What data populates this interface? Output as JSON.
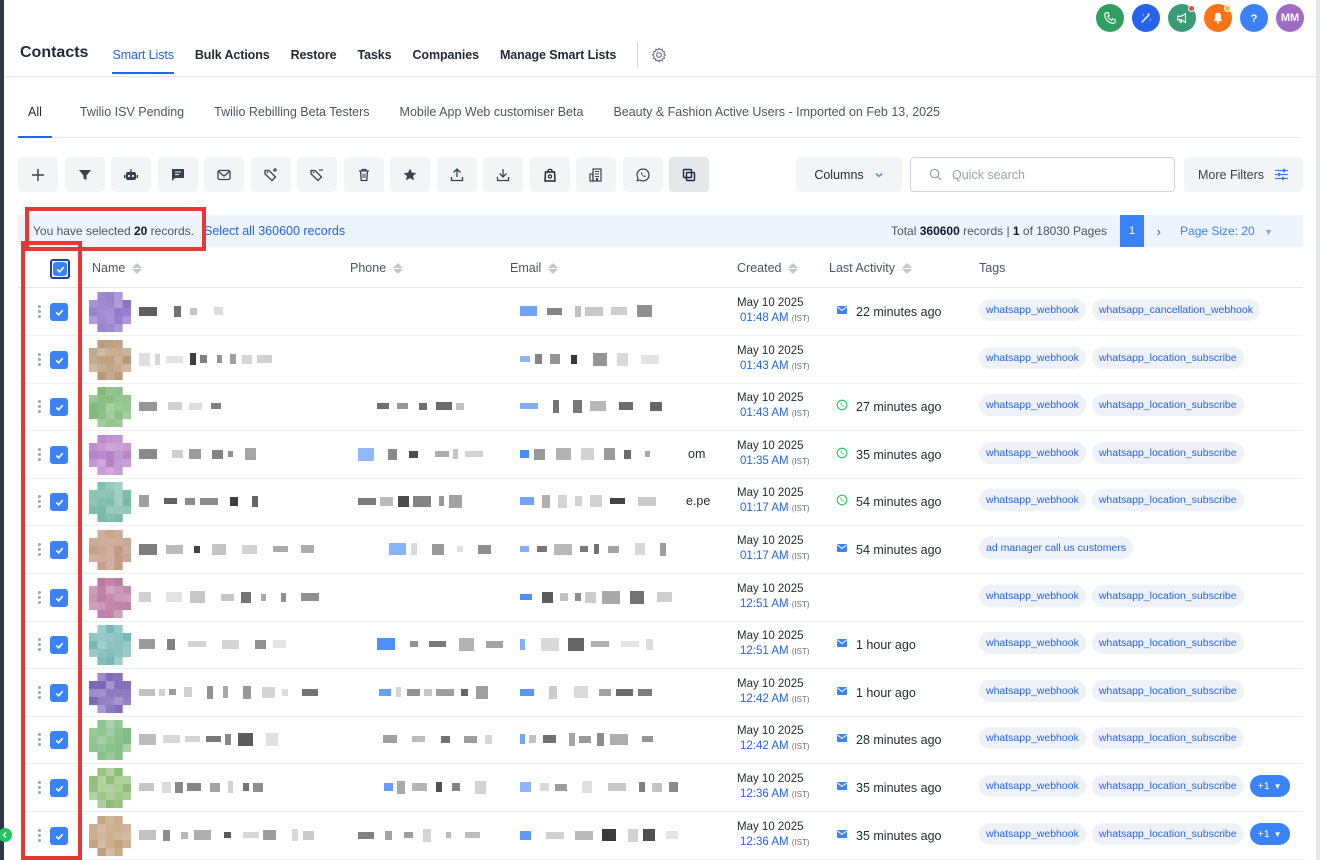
{
  "header": {
    "title": "Contacts",
    "nav_tabs": [
      {
        "label": "Smart Lists",
        "active": true
      },
      {
        "label": "Bulk Actions"
      },
      {
        "label": "Restore"
      },
      {
        "label": "Tasks"
      },
      {
        "label": "Companies"
      },
      {
        "label": "Manage Smart Lists"
      }
    ],
    "icons": [
      {
        "name": "phone-icon",
        "color": "#2f9e5f"
      },
      {
        "name": "magic-wand-icon",
        "color": "#2563eb"
      },
      {
        "name": "megaphone-icon",
        "color": "#3c9a74"
      },
      {
        "name": "bell-icon",
        "color": "#f97316"
      },
      {
        "name": "help-icon",
        "color": "#3b82f6"
      }
    ],
    "user_initials": "MM",
    "user_color": "#a26ac7"
  },
  "smart_lists": [
    "All",
    "Twilio ISV Pending",
    "Twilio Rebilling Beta Testers",
    "Mobile App Web customiser Beta",
    "Beauty & Fashion Active Users - Imported on Feb 13, 2025"
  ],
  "toolbar": {
    "columns_label": "Columns",
    "search_placeholder": "Quick search",
    "more_filters_label": "More Filters"
  },
  "selection": {
    "prefix": "You have selected ",
    "count": "20",
    "suffix": " records.",
    "select_all": "Select all 360600 records",
    "total_prefix": "Total ",
    "total_count": "360600",
    "total_mid": " records | ",
    "current_page": "1",
    "total_pages_text": " of 18030 Pages",
    "page_button": "1",
    "page_size": "Page Size: 20"
  },
  "table": {
    "columns": {
      "name": "Name",
      "phone": "Phone",
      "email": "Email",
      "created": "Created",
      "last_activity": "Last Activity",
      "tags": "Tags"
    },
    "rows": [
      {
        "date": "May 10 2025",
        "time": "01:48 AM",
        "tz": "(IST)",
        "activity": "22 minutes ago",
        "activity_type": "email",
        "tags": [
          "whatsapp_webhook",
          "whatsapp_cancellation_webhook"
        ],
        "more": "",
        "email_tail": ""
      },
      {
        "date": "May 10 2025",
        "time": "01:43 AM",
        "tz": "(IST)",
        "activity": "",
        "activity_type": "",
        "tags": [
          "whatsapp_webhook",
          "whatsapp_location_subscribe"
        ],
        "more": "",
        "email_tail": ""
      },
      {
        "date": "May 10 2025",
        "time": "01:43 AM",
        "tz": "(IST)",
        "activity": "27 minutes ago",
        "activity_type": "whatsapp",
        "tags": [
          "whatsapp_webhook",
          "whatsapp_location_subscribe"
        ],
        "more": "",
        "email_tail": ""
      },
      {
        "date": "May 10 2025",
        "time": "01:35 AM",
        "tz": "(IST)",
        "activity": "35 minutes ago",
        "activity_type": "whatsapp",
        "tags": [
          "whatsapp_webhook",
          "whatsapp_location_subscribe"
        ],
        "more": "",
        "email_tail": "om"
      },
      {
        "date": "May 10 2025",
        "time": "01:17 AM",
        "tz": "(IST)",
        "activity": "54 minutes ago",
        "activity_type": "whatsapp",
        "tags": [
          "whatsapp_webhook",
          "whatsapp_location_subscribe"
        ],
        "more": "",
        "email_tail": "e.pe"
      },
      {
        "date": "May 10 2025",
        "time": "01:17 AM",
        "tz": "(IST)",
        "activity": "54 minutes ago",
        "activity_type": "email",
        "tags": [
          "ad manager call us customers"
        ],
        "more": "",
        "email_tail": ""
      },
      {
        "date": "May 10 2025",
        "time": "12:51 AM",
        "tz": "(IST)",
        "activity": "",
        "activity_type": "",
        "tags": [
          "whatsapp_webhook",
          "whatsapp_location_subscribe"
        ],
        "more": "",
        "email_tail": ""
      },
      {
        "date": "May 10 2025",
        "time": "12:51 AM",
        "tz": "(IST)",
        "activity": "1 hour ago",
        "activity_type": "email",
        "tags": [
          "whatsapp_webhook",
          "whatsapp_location_subscribe"
        ],
        "more": "",
        "email_tail": ""
      },
      {
        "date": "May 10 2025",
        "time": "12:42 AM",
        "tz": "(IST)",
        "activity": "1 hour ago",
        "activity_type": "email",
        "tags": [
          "whatsapp_webhook",
          "whatsapp_location_subscribe"
        ],
        "more": "",
        "email_tail": ""
      },
      {
        "date": "May 10 2025",
        "time": "12:42 AM",
        "tz": "(IST)",
        "activity": "28 minutes ago",
        "activity_type": "email",
        "tags": [
          "whatsapp_webhook",
          "whatsapp_location_subscribe"
        ],
        "more": "",
        "email_tail": ""
      },
      {
        "date": "May 10 2025",
        "time": "12:36 AM",
        "tz": "(IST)",
        "activity": "35 minutes ago",
        "activity_type": "email",
        "tags": [
          "whatsapp_webhook",
          "whatsapp_location_subscribe"
        ],
        "more": "+1",
        "email_tail": ""
      },
      {
        "date": "May 10 2025",
        "time": "12:36 AM",
        "tz": "(IST)",
        "activity": "35 minutes ago",
        "activity_type": "email",
        "tags": [
          "whatsapp_webhook",
          "whatsapp_location_subscribe"
        ],
        "more": "+1",
        "email_tail": ""
      }
    ]
  },
  "colors": {
    "accent": "#2563eb",
    "highlight_box": "#e53935",
    "avatars": [
      "#8a6ec4",
      "#b99674",
      "#7fb877",
      "#b57dc6",
      "#74b8a3",
      "#b98b72",
      "#b9779f",
      "#71b6b3",
      "#7a62b5",
      "#7dbb7e",
      "#8cbb73",
      "#c0a07c"
    ]
  }
}
